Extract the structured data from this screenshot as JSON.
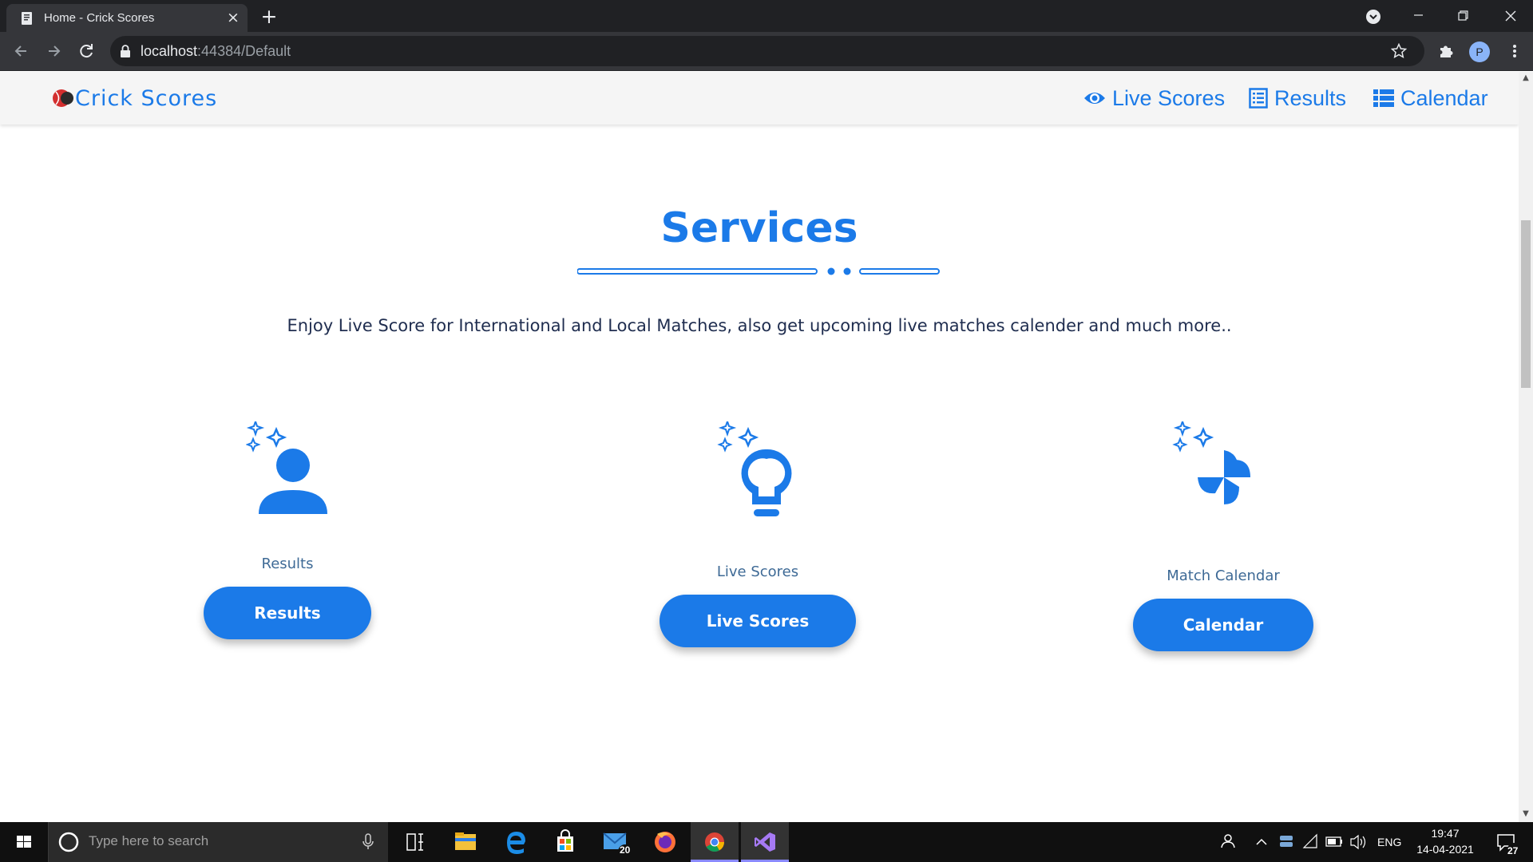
{
  "browser": {
    "tab_title": "Home - Crick Scores",
    "url_host": "localhost",
    "url_rest": ":44384/Default",
    "profile_initial": "P"
  },
  "site": {
    "logo_text": "Crick Scores",
    "nav": [
      {
        "label": "Live Scores",
        "icon": "eye-icon"
      },
      {
        "label": "Results",
        "icon": "list-icon"
      },
      {
        "label": "Calendar",
        "icon": "table-list-icon"
      }
    ]
  },
  "services": {
    "title": "Services",
    "description": "Enjoy Live Score for International and Local Matches, also get upcoming live matches calender and much more..",
    "cards": [
      {
        "label": "Results",
        "button": "Results",
        "icon": "user-sparkle-icon"
      },
      {
        "label": "Live Scores",
        "button": "Live Scores",
        "icon": "lightbulb-sparkle-icon"
      },
      {
        "label": "Match Calendar",
        "button": "Calendar",
        "icon": "pinwheel-sparkle-icon"
      }
    ]
  },
  "taskbar": {
    "search_placeholder": "Type here to search",
    "mail_badge": "20",
    "language": "ENG",
    "time": "19:47",
    "date": "14-04-2021",
    "notification_count": "27"
  },
  "colors": {
    "brand": "#1b7ae8",
    "chrome_dark": "#202124"
  }
}
